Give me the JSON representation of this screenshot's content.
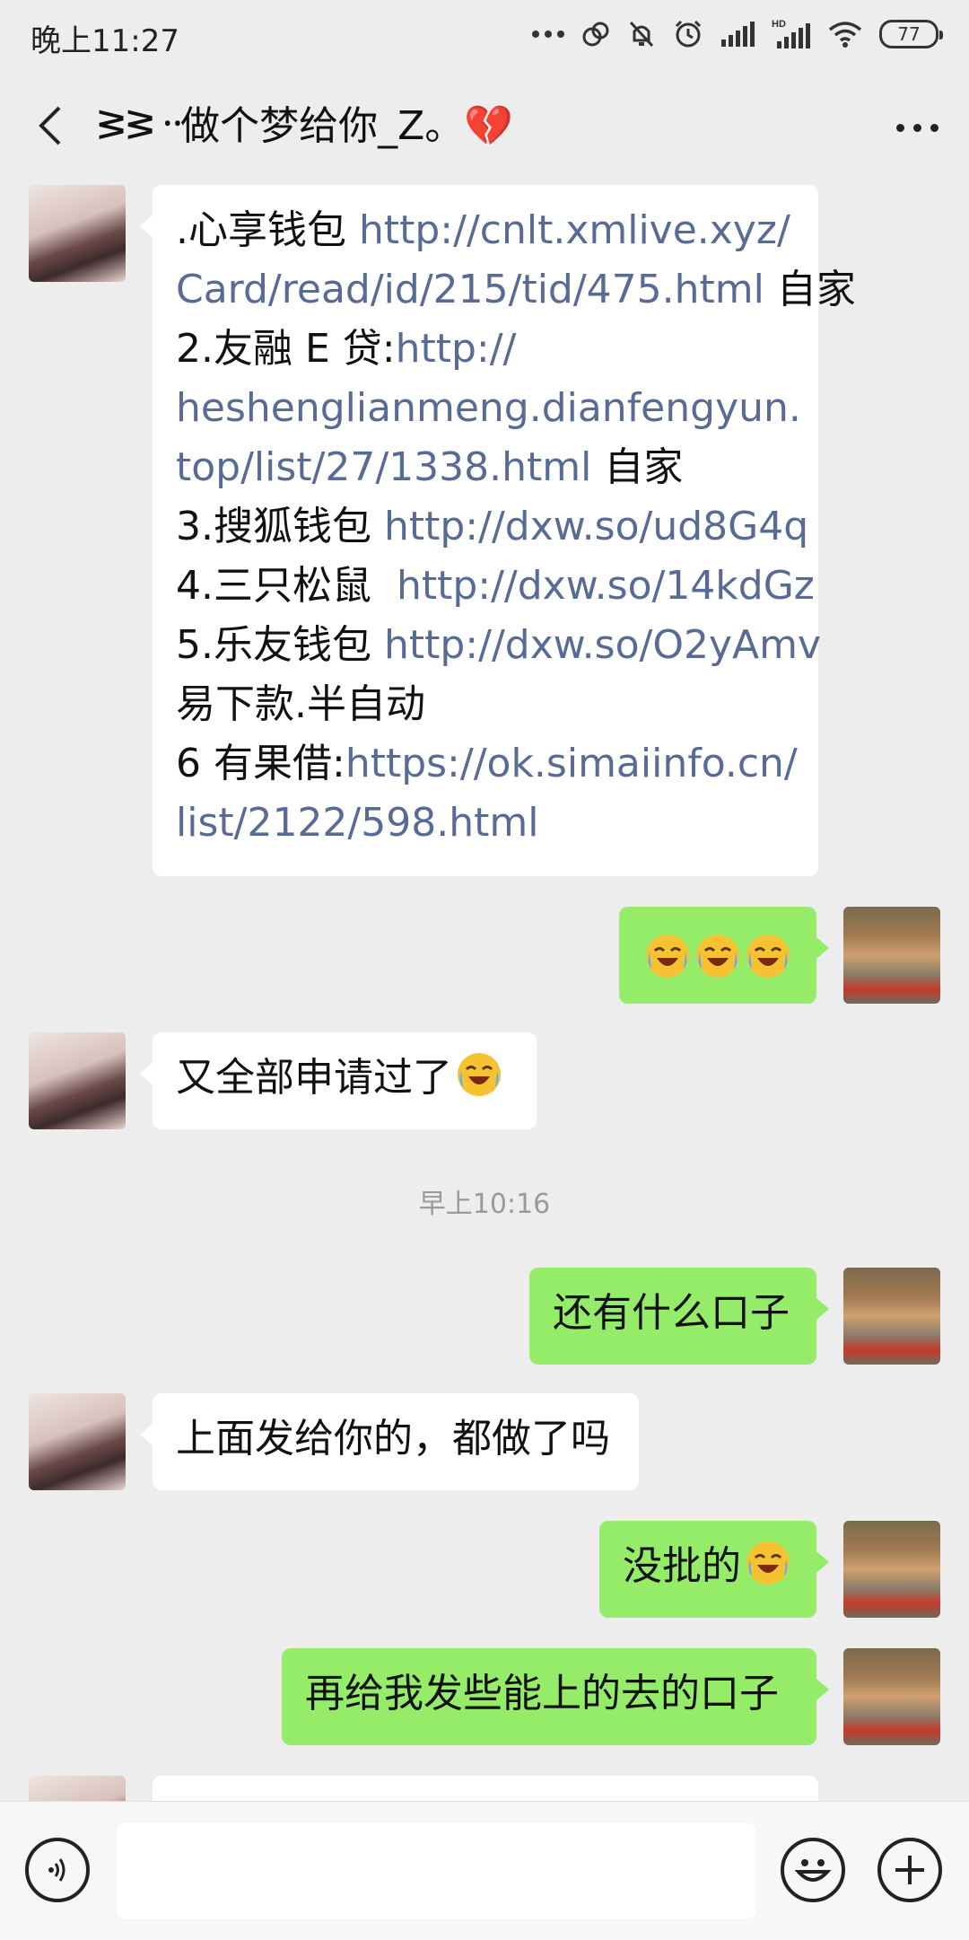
{
  "status_bar": {
    "time": "晚上11:27",
    "battery": "77"
  },
  "header": {
    "title": "ᕒᕒ᠃做个梦给你_Z。💔"
  },
  "messages": {
    "m1": {
      "line1_text": ".心享钱包 ",
      "line1_link": "http://cnlt.xmlive.xyz/",
      "line2_link": "Card/read/id/215/tid/475.html",
      "line2_text": " 自家",
      "line3_text": "2.友融 E 贷:",
      "line3_link": "http://",
      "line4_link": "heshenglianmeng.dianfengyun.",
      "line5_link": "top/list/27/1338.html",
      "line5_text": " 自家",
      "line6_text": "3.搜狐钱包 ",
      "line6_link": "http://dxw.so/ud8G4q",
      "line7_text": "4.三只松鼠  ",
      "line7_link": "http://dxw.so/14kdGz",
      "line8_text": "5.乐友钱包 ",
      "line8_link": "http://dxw.so/O2yAmv",
      "line9_text": "易下款.半自动",
      "line10_text": "6 有果借:",
      "line10_link": "https://ok.simaiinfo.cn/",
      "line11_link": "list/2122/598.html"
    },
    "m3": {
      "text": "又全部申请过了"
    },
    "time_label": "早上10:16",
    "m4": {
      "text": "还有什么口子"
    },
    "m5": {
      "text": "上面发给你的，都做了吗"
    },
    "m6": {
      "text": "没批的"
    },
    "m7": {
      "text": "再给我发些能上的去的口子"
    }
  },
  "input": {
    "placeholder": ""
  },
  "icons": {
    "status": [
      "more-dots-icon",
      "link-icon",
      "mute-icon",
      "alarm-icon",
      "signal-icon",
      "hd-signal-icon",
      "wifi-icon",
      "battery-icon"
    ],
    "emoji": "face-with-tears-of-joy"
  },
  "colors": {
    "background": "#ededed",
    "bubble_incoming": "#ffffff",
    "bubble_outgoing": "#95ec69",
    "link": "#576b95"
  }
}
